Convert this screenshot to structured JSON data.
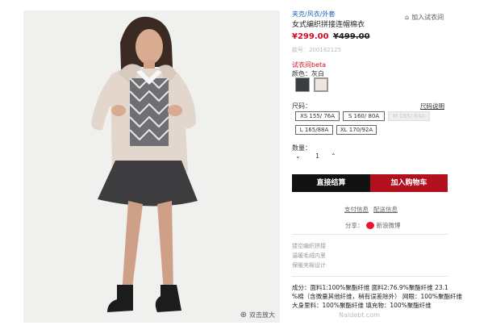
{
  "product": {
    "breadcrumb": "夹克/风衣/外套",
    "try_on": "加入试衣间",
    "title": "女式编织拼接连帽棉衣",
    "price": "¥299.00",
    "old_price": "¥499.00",
    "sku": "款号：200162125",
    "fitting_room": "试衣间beta",
    "color_line": "颜色：灰白",
    "colors": [
      {
        "name": "dark-gray",
        "hex": "#3a3d42"
      },
      {
        "name": "off-white",
        "hex": "#efe6e0"
      }
    ],
    "size_label": "尺码：",
    "size_chart": "尺码说明",
    "sizes": [
      {
        "label": "XS 155/ 76A",
        "available": true
      },
      {
        "label": "S 160/ 80A",
        "available": true
      },
      {
        "label": "M 165/ 84A",
        "available": false
      },
      {
        "label": "L 165/88A",
        "available": true
      },
      {
        "label": "XL 170/92A",
        "available": true
      }
    ],
    "quantity_label": "数量：",
    "quantity": "1",
    "buy_now": "直接结算",
    "add_to_cart": "加入购物车",
    "payment_link": "支付信息",
    "delivery_link": "配送信息",
    "share_label": "分享：",
    "share_weibo": "新浪微博",
    "features": [
      "镂空编织拼接",
      "温暖毛绒内里",
      "保暖夹棉设计"
    ],
    "composition": [
      "成分：面料1:100%聚酯纤维 面料2:76.9%聚酯纤维 23.1",
      "%棉（含微量其他纤维，稍有误差除外） 网眼：100%聚酯纤维",
      "大身里料：100%聚酯纤维 填充物：100%聚酯纤维"
    ],
    "zoom": "双击放大",
    "watermark": "Naldebt.com"
  }
}
